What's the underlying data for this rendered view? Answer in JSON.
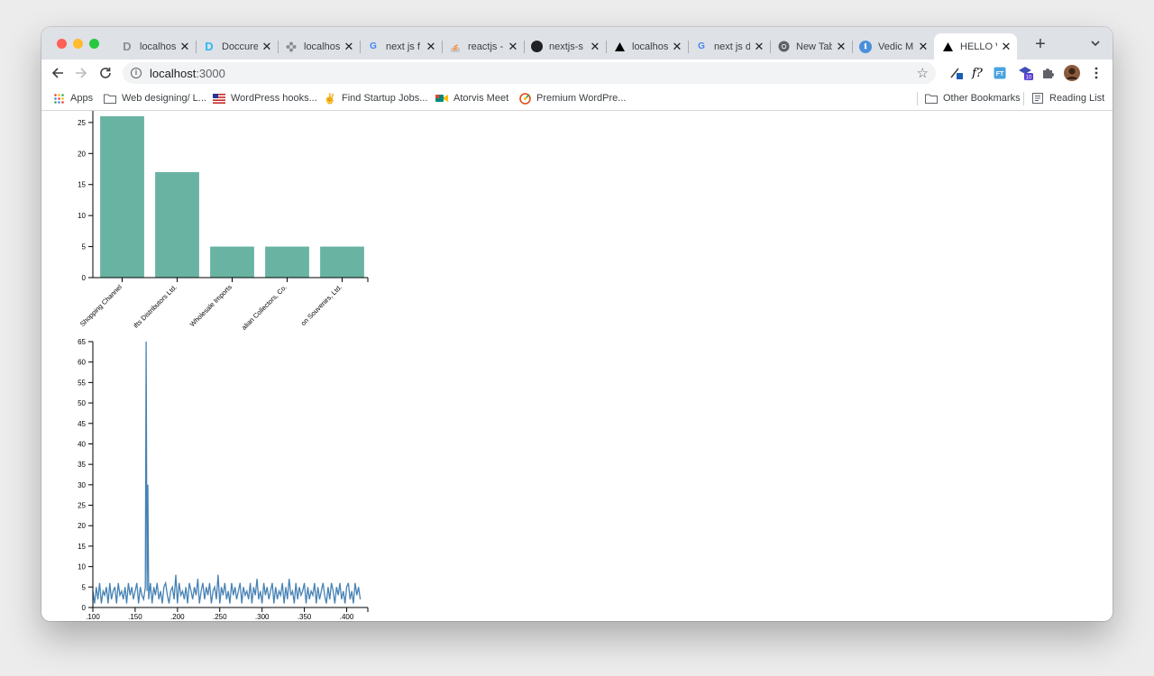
{
  "tabs": [
    {
      "title": "localhost",
      "icon": "doccure-grey-icon"
    },
    {
      "title": "Doccure",
      "icon": "doccure-blue-icon"
    },
    {
      "title": "localhost",
      "icon": "pinwheel-icon"
    },
    {
      "title": "next js f",
      "icon": "google-icon"
    },
    {
      "title": "reactjs -",
      "icon": "stackoverflow-icon"
    },
    {
      "title": "nextjs-s",
      "icon": "github-icon"
    },
    {
      "title": "localhost",
      "icon": "triangle-icon"
    },
    {
      "title": "next js d",
      "icon": "google-icon"
    },
    {
      "title": "New Tab",
      "icon": "chrome-icon"
    },
    {
      "title": "Vedic M",
      "icon": "vedic-icon"
    },
    {
      "title": "HELLO V",
      "icon": "triangle-icon",
      "active": true
    }
  ],
  "toolbar": {
    "url_host": "localhost",
    "url_port": ":3000"
  },
  "bookmarks": {
    "apps": "Apps",
    "items": [
      {
        "label": "Web designing/ L..."
      },
      {
        "label": "WordPress hooks..."
      },
      {
        "label": "Find Startup Jobs..."
      },
      {
        "label": "Atorvis Meet"
      },
      {
        "label": "Premium WordPre..."
      }
    ],
    "other": "Other Bookmarks",
    "reading": "Reading List"
  },
  "colors": {
    "bar": "#69b3a2",
    "line": "#4682b4",
    "axis": "#000000"
  },
  "chart_data": [
    {
      "type": "bar",
      "categories": [
        "Shopping Channel",
        "Gifts Distributors Ltd.",
        "Wholesale Imports",
        "Australian Collectors, Co.",
        "Toys Souvenirs, Ltd."
      ],
      "category_labels_shown": [
        "Shopping Channel",
        "ifts Distributors Ltd.",
        "Wholesale Imports",
        "alian Collectors, Co.",
        "on Souvenirs, Ltd."
      ],
      "values": [
        26,
        17,
        5,
        5,
        5
      ],
      "ylim": [
        0,
        26
      ],
      "yticks": [
        0,
        5,
        10,
        15,
        20,
        25
      ],
      "xlabel": "",
      "ylabel": ""
    },
    {
      "type": "line",
      "xlim": [
        0.1,
        0.425
      ],
      "xticks": [
        0.1,
        0.15,
        0.2,
        0.25,
        0.3,
        0.35,
        0.4
      ],
      "xtick_labels": [
        ".100",
        ".150",
        ".200",
        ".250",
        ".300",
        ".350",
        ".400"
      ],
      "ylim": [
        0,
        65
      ],
      "yticks": [
        0,
        5,
        10,
        15,
        20,
        25,
        30,
        35,
        40,
        45,
        50,
        55,
        60,
        65
      ],
      "x": [
        0.1,
        0.102,
        0.104,
        0.106,
        0.108,
        0.11,
        0.112,
        0.114,
        0.116,
        0.118,
        0.12,
        0.122,
        0.124,
        0.126,
        0.128,
        0.13,
        0.132,
        0.134,
        0.136,
        0.138,
        0.14,
        0.142,
        0.144,
        0.146,
        0.148,
        0.15,
        0.152,
        0.154,
        0.156,
        0.158,
        0.16,
        0.162,
        0.163,
        0.164,
        0.165,
        0.166,
        0.168,
        0.17,
        0.172,
        0.174,
        0.176,
        0.178,
        0.18,
        0.182,
        0.184,
        0.186,
        0.188,
        0.19,
        0.192,
        0.194,
        0.196,
        0.198,
        0.2,
        0.202,
        0.204,
        0.206,
        0.208,
        0.21,
        0.212,
        0.214,
        0.216,
        0.218,
        0.22,
        0.222,
        0.224,
        0.226,
        0.228,
        0.23,
        0.232,
        0.234,
        0.236,
        0.238,
        0.24,
        0.242,
        0.244,
        0.246,
        0.248,
        0.25,
        0.252,
        0.254,
        0.256,
        0.258,
        0.26,
        0.262,
        0.264,
        0.266,
        0.268,
        0.27,
        0.272,
        0.274,
        0.276,
        0.278,
        0.28,
        0.282,
        0.284,
        0.286,
        0.288,
        0.29,
        0.292,
        0.294,
        0.296,
        0.298,
        0.3,
        0.302,
        0.304,
        0.306,
        0.308,
        0.31,
        0.312,
        0.314,
        0.316,
        0.318,
        0.32,
        0.322,
        0.324,
        0.326,
        0.328,
        0.33,
        0.332,
        0.334,
        0.336,
        0.338,
        0.34,
        0.342,
        0.344,
        0.346,
        0.348,
        0.35,
        0.352,
        0.354,
        0.356,
        0.358,
        0.36,
        0.362,
        0.364,
        0.366,
        0.368,
        0.37,
        0.372,
        0.374,
        0.376,
        0.378,
        0.38,
        0.382,
        0.384,
        0.386,
        0.388,
        0.39,
        0.392,
        0.394,
        0.396,
        0.398,
        0.4,
        0.402,
        0.404,
        0.406,
        0.408,
        0.41,
        0.412,
        0.414,
        0.416,
        0.418,
        0.42,
        0.422
      ],
      "y": [
        4,
        1,
        5,
        2,
        6,
        1,
        4,
        3,
        5,
        1,
        6,
        2,
        4,
        5,
        1,
        6,
        3,
        4,
        2,
        5,
        1,
        6,
        3,
        5,
        2,
        4,
        6,
        1,
        5,
        3,
        2,
        5,
        65,
        4,
        30,
        2,
        6,
        1,
        5,
        3,
        6,
        2,
        4,
        1,
        5,
        6,
        3,
        1,
        4,
        5,
        2,
        8,
        1,
        6,
        3,
        4,
        2,
        5,
        1,
        6,
        4,
        2,
        5,
        3,
        7,
        1,
        4,
        6,
        2,
        5,
        3,
        6,
        1,
        4,
        5,
        2,
        8,
        1,
        5,
        3,
        6,
        2,
        4,
        1,
        6,
        3,
        5,
        2,
        4,
        6,
        1,
        5,
        3,
        4,
        2,
        6,
        1,
        5,
        3,
        7,
        2,
        4,
        1,
        6,
        3,
        5,
        2,
        4,
        6,
        1,
        5,
        2,
        4,
        3,
        6,
        1,
        5,
        2,
        7,
        3,
        4,
        1,
        6,
        2,
        5,
        3,
        4,
        6,
        1,
        5,
        2,
        4,
        3,
        6,
        1,
        5,
        2,
        4,
        6,
        3,
        1,
        5,
        2,
        6,
        4,
        1,
        5,
        3,
        6,
        2,
        4,
        1,
        5,
        6,
        2,
        4,
        1,
        6,
        3,
        5,
        2
      ],
      "xlabel": "",
      "ylabel": ""
    }
  ]
}
